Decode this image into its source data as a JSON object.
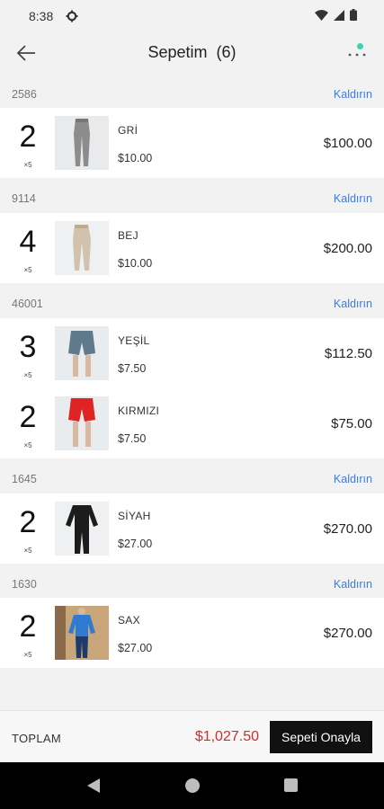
{
  "status_bar": {
    "time": "8:38"
  },
  "header": {
    "title": "Sepetim  (6)"
  },
  "groups": [
    {
      "code": "2586",
      "remove_label": "Kaldırın",
      "items": [
        {
          "qty": "2",
          "unit": "×5",
          "color": "GRİ",
          "unit_price": "$10.00",
          "total": "$100.00",
          "icon": "pants-gray"
        }
      ]
    },
    {
      "code": "9114",
      "remove_label": "Kaldırın",
      "items": [
        {
          "qty": "4",
          "unit": "×5",
          "color": "BEJ",
          "unit_price": "$10.00",
          "total": "$200.00",
          "icon": "pants-beige"
        }
      ]
    },
    {
      "code": "46001",
      "remove_label": "Kaldırın",
      "items": [
        {
          "qty": "3",
          "unit": "×5",
          "color": "YEŞİL",
          "unit_price": "$7.50",
          "total": "$112.50",
          "icon": "shorts-green"
        },
        {
          "qty": "2",
          "unit": "×5",
          "color": "KIRMIZI",
          "unit_price": "$7.50",
          "total": "$75.00",
          "icon": "shorts-red"
        }
      ]
    },
    {
      "code": "1645",
      "remove_label": "Kaldırın",
      "items": [
        {
          "qty": "2",
          "unit": "×5",
          "color": "SİYAH",
          "unit_price": "$27.00",
          "total": "$270.00",
          "icon": "tracksuit-black"
        }
      ]
    },
    {
      "code": "1630",
      "remove_label": "Kaldırın",
      "items": [
        {
          "qty": "2",
          "unit": "×5",
          "color": "SAX",
          "unit_price": "$27.00",
          "total": "$270.00",
          "icon": "tracksuit-blue"
        }
      ]
    }
  ],
  "footer": {
    "total_label": "TOPLAM",
    "total_value": "$1,027.50",
    "confirm_label": "Sepeti Onayla"
  },
  "colors": {
    "accent_link": "#3a7de0",
    "total_price": "#d62b2b",
    "notification_dot": "#3ed2b0"
  }
}
